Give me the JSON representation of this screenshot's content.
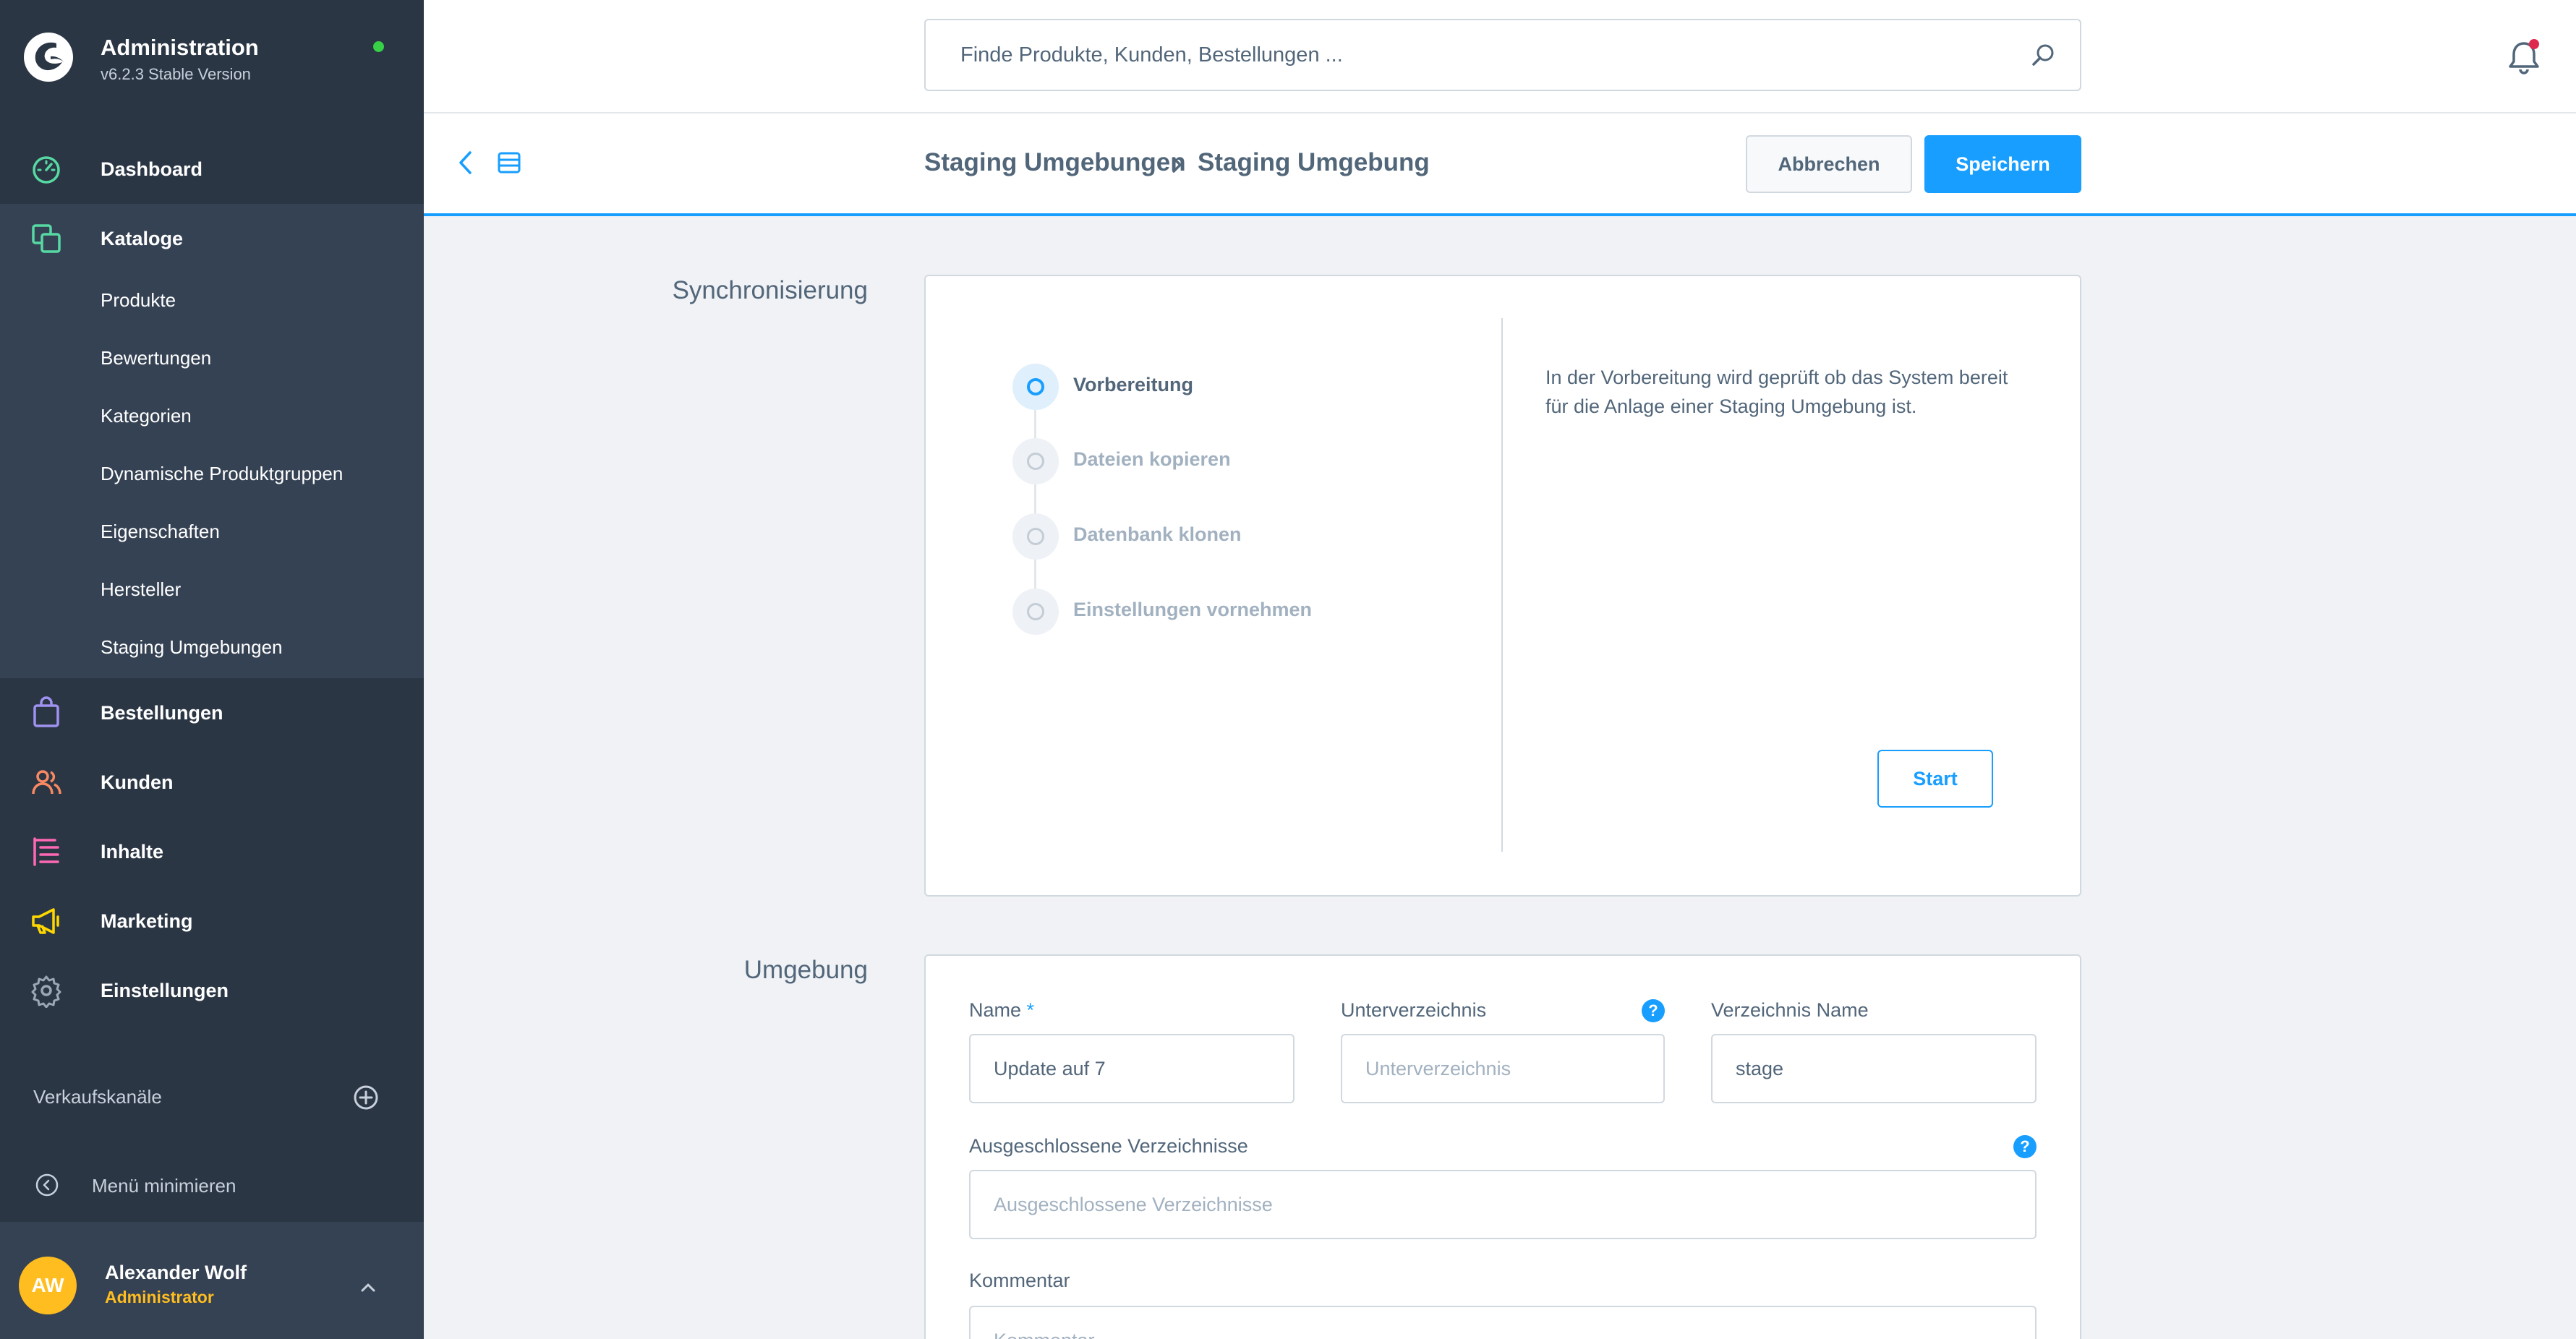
{
  "app": {
    "title": "Administration",
    "version": "v6.2.3 Stable Version"
  },
  "colors": {
    "sidebar_bg": "#2b3645",
    "accent": "#189eff",
    "status_online": "#37d046",
    "user_role": "#ffbd1f"
  },
  "sidebar": {
    "nav": [
      {
        "label": "Dashboard",
        "icon": "dashboard-gauge-icon",
        "color": "#57d9a3"
      },
      {
        "label": "Kataloge",
        "icon": "catalog-squares-icon",
        "color": "#57d9a3"
      },
      {
        "label": "Bestellungen",
        "icon": "shopping-bag-icon",
        "color": "#a092f0"
      },
      {
        "label": "Kunden",
        "icon": "users-icon",
        "color": "#f88962"
      },
      {
        "label": "Inhalte",
        "icon": "content-list-icon",
        "color": "#ff68b4"
      },
      {
        "label": "Marketing",
        "icon": "megaphone-icon",
        "color": "#ffd700"
      },
      {
        "label": "Einstellungen",
        "icon": "gear-icon",
        "color": "#9aa8b5"
      }
    ],
    "catalog_items": [
      "Produkte",
      "Bewertungen",
      "Kategorien",
      "Dynamische Produktgruppen",
      "Eigenschaften",
      "Hersteller",
      "Staging Umgebungen"
    ],
    "sales_channels_label": "Verkaufskanäle",
    "minimize_label": "Menü minimieren",
    "user": {
      "initials": "AW",
      "name": "Alexander Wolf",
      "role": "Administrator"
    }
  },
  "topbar": {
    "search_placeholder": "Finde Produkte, Kunden, Bestellungen ..."
  },
  "smartbar": {
    "breadcrumb": [
      "Staging Umgebungen",
      "Staging Umgebung"
    ],
    "cancel_label": "Abbrechen",
    "save_label": "Speichern"
  },
  "sync": {
    "title": "Synchronisierung",
    "steps": [
      {
        "label": "Vorbereitung",
        "active": true
      },
      {
        "label": "Dateien kopieren",
        "active": false
      },
      {
        "label": "Datenbank klonen",
        "active": false
      },
      {
        "label": "Einstellungen vornehmen",
        "active": false
      }
    ],
    "description": "In der Vorbereitung wird geprüft ob das System bereit für die Anlage einer Staging Umgebung ist.",
    "start_label": "Start"
  },
  "environment": {
    "title": "Umgebung",
    "name_label": "Name",
    "name_required": "*",
    "name_value": "Update auf 7",
    "subdir_label": "Unterverzeichnis",
    "subdir_placeholder": "Unterverzeichnis",
    "dirname_label": "Verzeichnis Name",
    "dirname_value": "stage",
    "excluded_label": "Ausgeschlossene Verzeichnisse",
    "excluded_placeholder": "Ausgeschlossene Verzeichnisse",
    "comment_label": "Kommentar",
    "comment_placeholder": "Kommentar",
    "help_glyph": "?"
  }
}
